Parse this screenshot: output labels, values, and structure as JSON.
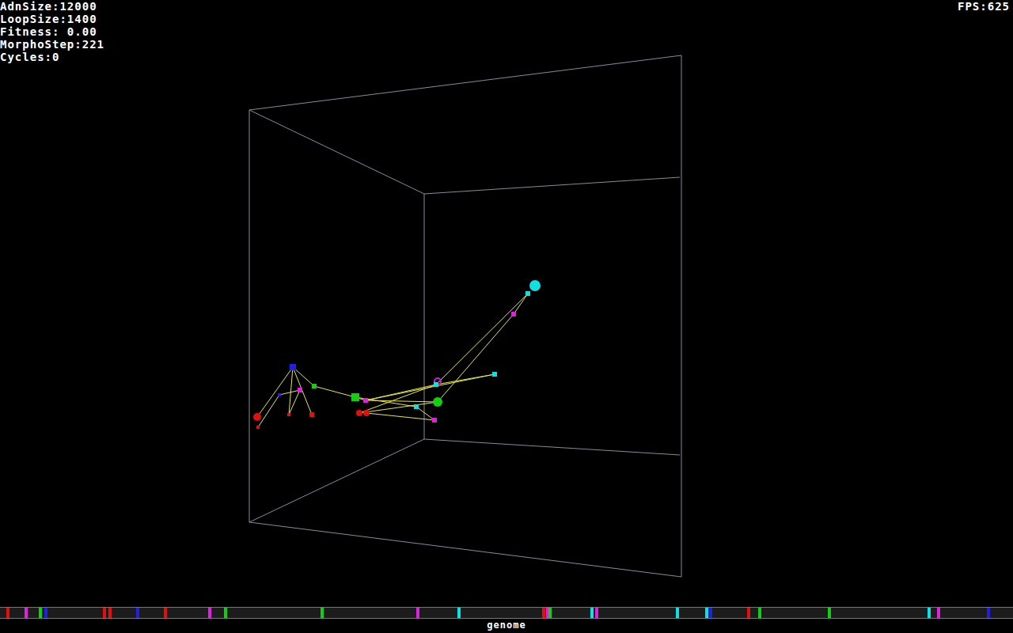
{
  "hud": {
    "lines": [
      "AdnSize:12000",
      "LoopSize:1400",
      "Fitness: 0.00",
      "MorphoStep:221",
      "Cycles:0"
    ],
    "fps": "FPS:625"
  },
  "genome": {
    "label": "genome",
    "length": 12000,
    "genes": [
      {
        "locus": 75,
        "color": "#e01010"
      },
      {
        "locus": 290,
        "color": "#e020e0"
      },
      {
        "locus": 460,
        "color": "#10d010"
      },
      {
        "locus": 525,
        "color": "#2020e0"
      },
      {
        "locus": 1220,
        "color": "#e01010"
      },
      {
        "locus": 1285,
        "color": "#e01010"
      },
      {
        "locus": 1610,
        "color": "#2020e0"
      },
      {
        "locus": 1940,
        "color": "#e01010"
      },
      {
        "locus": 2465,
        "color": "#e020e0"
      },
      {
        "locus": 2655,
        "color": "#10d010"
      },
      {
        "locus": 3795,
        "color": "#10d010"
      },
      {
        "locus": 4930,
        "color": "#e020e0"
      },
      {
        "locus": 5420,
        "color": "#10e0e0"
      },
      {
        "locus": 6420,
        "color": "#e01010"
      },
      {
        "locus": 6470,
        "color": "#e020e0"
      },
      {
        "locus": 6500,
        "color": "#10d010"
      },
      {
        "locus": 6995,
        "color": "#10e0e0"
      },
      {
        "locus": 7050,
        "color": "#e020e0"
      },
      {
        "locus": 8005,
        "color": "#10e0e0"
      },
      {
        "locus": 8355,
        "color": "#10e0e0"
      },
      {
        "locus": 8400,
        "color": "#2020e0"
      },
      {
        "locus": 8850,
        "color": "#e01010"
      },
      {
        "locus": 8980,
        "color": "#10d010"
      },
      {
        "locus": 9805,
        "color": "#10d010"
      },
      {
        "locus": 10990,
        "color": "#10e0e0"
      },
      {
        "locus": 11100,
        "color": "#e020e0"
      },
      {
        "locus": 11690,
        "color": "#2020e0"
      }
    ]
  }
}
